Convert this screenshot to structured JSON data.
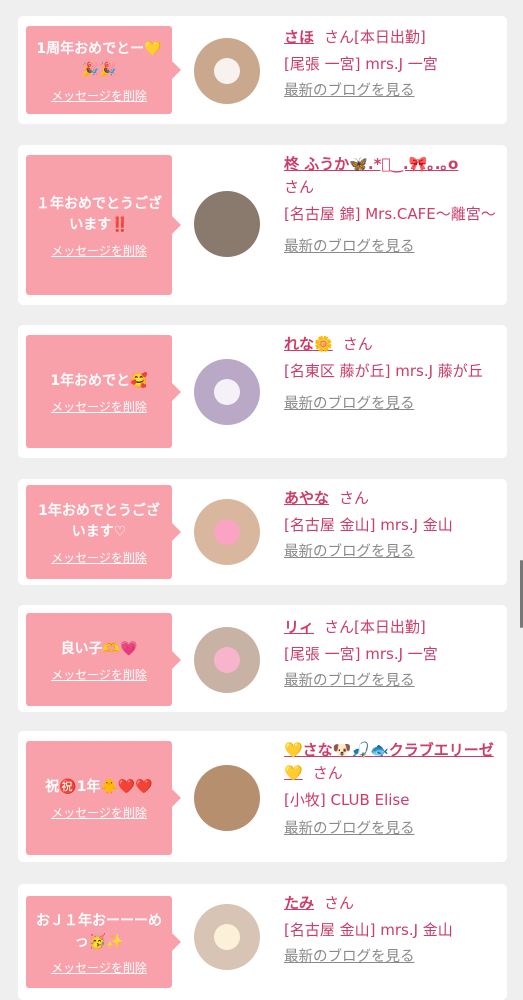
{
  "entries": [
    {
      "message": "1周年おめでとー💛🎉🎉",
      "delete_label": "メッセージを削除",
      "name": "さほ",
      "honorific": "さん",
      "status": "[本日出勤]",
      "shop": "[尾張 一宮] mrs.J 一宮",
      "blog_label": "最新のブログを見る",
      "avatar_color": "#c9a88e"
    },
    {
      "message": "１年おめでとうございます‼️",
      "delete_label": "メッセージを削除",
      "name": "柊 ふうか🦋.*ﾟ‿.🎀｡.｡o",
      "honorific": "さん",
      "status": "",
      "shop": "[名古屋 錦] Mrs.CAFE〜離宮〜",
      "blog_label": "最新のブログを見る",
      "avatar_color": "#8a7a6e"
    },
    {
      "message": "1年おめでと🥰",
      "delete_label": "メッセージを削除",
      "name": "れな🌼",
      "honorific": "さん",
      "status": "",
      "shop": "[名東区 藤が丘] mrs.J 藤が丘",
      "blog_label": "最新のブログを見る",
      "avatar_color": "#b9a9c7"
    },
    {
      "message": "1年おめでとうございます♡",
      "delete_label": "メッセージを削除",
      "name": "あやな",
      "honorific": "さん",
      "status": "",
      "shop": "[名古屋 金山] mrs.J 金山",
      "blog_label": "最新のブログを見る",
      "avatar_color": "#d9b79e"
    },
    {
      "message": "良い子🫶💗",
      "delete_label": "メッセージを削除",
      "name": "リィ",
      "honorific": "さん",
      "status": "[本日出勤]",
      "shop": "[尾張 一宮] mrs.J 一宮",
      "blog_label": "最新のブログを見る",
      "avatar_color": "#c8b2a4"
    },
    {
      "message": "祝㊗️1年🐥❤️❤️",
      "delete_label": "メッセージを削除",
      "name": "💛さな🐶🎣🐟クラブエリーゼ💛",
      "honorific": "さん",
      "status": "",
      "shop": "[小牧] CLUB Elise",
      "blog_label": "最新のブログを見る",
      "avatar_color": "#b58f6e"
    },
    {
      "message": "おＪ１年おーーーめっ🥳✨",
      "delete_label": "メッセージを削除",
      "name": "たみ",
      "honorific": "さん",
      "status": "",
      "shop": "[名古屋 金山] mrs.J 金山",
      "blog_label": "最新のブログを見る",
      "avatar_color": "#d8c4b4"
    }
  ]
}
